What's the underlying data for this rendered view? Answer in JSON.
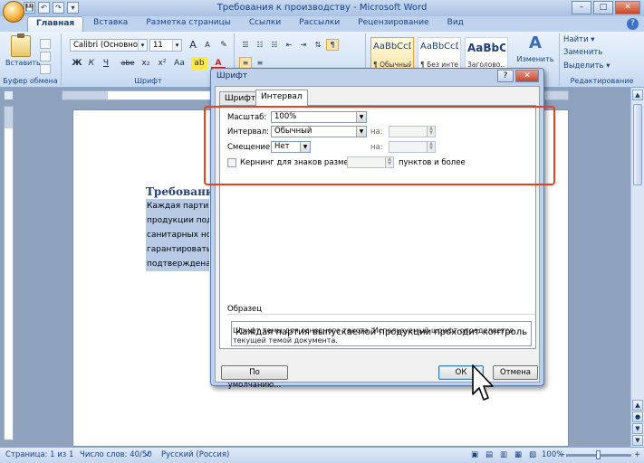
{
  "window": {
    "title": "Требования к производству - Microsoft Word",
    "min": "–",
    "max": "□",
    "close": "✕"
  },
  "qat": [
    "💾",
    "↶",
    "↷",
    "▾"
  ],
  "tabs": [
    {
      "label": "Главная"
    },
    {
      "label": "Вставка"
    },
    {
      "label": "Разметка страницы"
    },
    {
      "label": "Ссылки"
    },
    {
      "label": "Рассылки"
    },
    {
      "label": "Рецензирование"
    },
    {
      "label": "Вид"
    }
  ],
  "help": "?",
  "ribbon": {
    "paste_label": "Вставить",
    "clipboard_group": "Буфер обмена",
    "font_group": "Шрифт",
    "font_name": "Calibri (Основной те",
    "font_size": "11",
    "grow": "A",
    "shrink": "A",
    "clear": "✎",
    "bold": "Ж",
    "italic": "К",
    "underline": "Ч",
    "strike": "abe",
    "sub": "x₂",
    "sup": "x²",
    "case": "Aa",
    "highlight": "ab",
    "fontcolor": "A",
    "styles": [
      {
        "sample": "AaBbCcDc",
        "caption": "¶ Обычный"
      },
      {
        "sample": "AaBbCcDc",
        "caption": "¶ Без инте..."
      },
      {
        "sample": "AaBbC",
        "caption": "Заголово..."
      }
    ],
    "change_styles_label": "Изменить",
    "change_styles_icon": "A",
    "find_label": "Найти ▾",
    "replace_label": "Заменить",
    "select_label": "Выделить ▾",
    "editing_group": "Редактирование"
  },
  "document": {
    "heading": "Требования",
    "lines": [
      "Каждая партия в",
      "продукции подв",
      "санитарных нор",
      "гарантировать п",
      "подтверждена р"
    ]
  },
  "dialog": {
    "title": "Шрифт",
    "help_btn": "?",
    "close_btn": "✕",
    "tab_font": "Шрифт",
    "tab_interval": "Интервал",
    "scale_label": "Масштаб:",
    "scale_value": "100%",
    "spacing_label": "Интервал:",
    "spacing_value": "Обычный",
    "spacing_by_label": "на:",
    "position_label": "Смещение:",
    "position_value": "Нет",
    "position_by_label": "на:",
    "kerning_label": "Кернинг для знаков размером:",
    "kerning_suffix": "пунктов и более",
    "sample_legend": "Образец",
    "sample_text": "Каждая партия выпускаемой продукции проходит контроль в заводской ла",
    "sample_note": "Шрифт темы для основного текста. Используемый шрифт определяется текущей темой документа.",
    "default_btn": "По умолчанию...",
    "ok_btn": "ОК",
    "cancel_btn": "Отмена"
  },
  "status": {
    "page": "Страница: 1 из 1",
    "words": "Число слов: 40/50",
    "language": "Русский (Россия)",
    "zoom": "100%",
    "zoom_minus": "−",
    "zoom_plus": "+"
  },
  "colors": {
    "highlight": "#e8401c",
    "ribbon_accent": "#15428b",
    "selection": "#b8cbe6"
  }
}
